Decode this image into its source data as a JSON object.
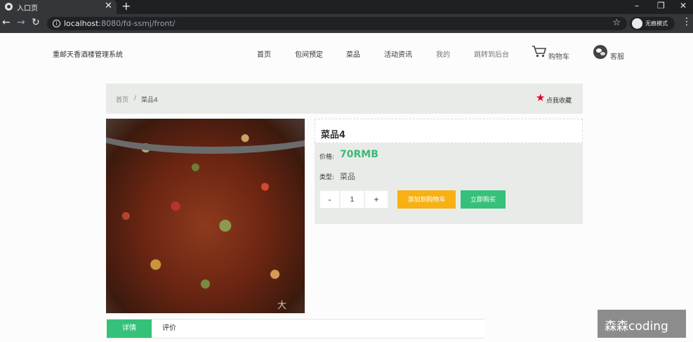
{
  "browser": {
    "tab_title": "入口页",
    "tab_close": "✕",
    "new_tab": "+",
    "url_host": "localhost",
    "url_path": ":8080/fd-ssmj/front/",
    "incognito_label": "无痕模式",
    "window_min": "–",
    "window_restore": "❐",
    "window_close": "✕",
    "back": "←",
    "forward": "→",
    "reload": "↻"
  },
  "header": {
    "site_title": "重邮天香酒楼管理系统",
    "nav": [
      {
        "label": "首页"
      },
      {
        "label": "包间预定"
      },
      {
        "label": "菜品"
      },
      {
        "label": "活动资讯"
      },
      {
        "label": "我的"
      },
      {
        "label": "跳转到后台"
      }
    ],
    "cart_label": "购物车",
    "service_label": "客服"
  },
  "breadcrumb": {
    "home": "首页",
    "separator": "/",
    "current": "菜品4",
    "favorite_label": "点我收藏"
  },
  "product": {
    "image_watermark": "大",
    "name": "菜品4",
    "price_label": "价格:",
    "price_value": "70RMB",
    "type_label": "类型:",
    "type_value": "菜品",
    "qty_minus": "-",
    "quantity": "1",
    "qty_plus": "+",
    "add_to_cart": "添加到购物车",
    "buy_now": "立即购买",
    "accent_green": "#35c179",
    "accent_orange": "#f9b013"
  },
  "tabs": [
    {
      "label": "详情"
    },
    {
      "label": "评价"
    }
  ],
  "overlay_watermark": "森森coding"
}
